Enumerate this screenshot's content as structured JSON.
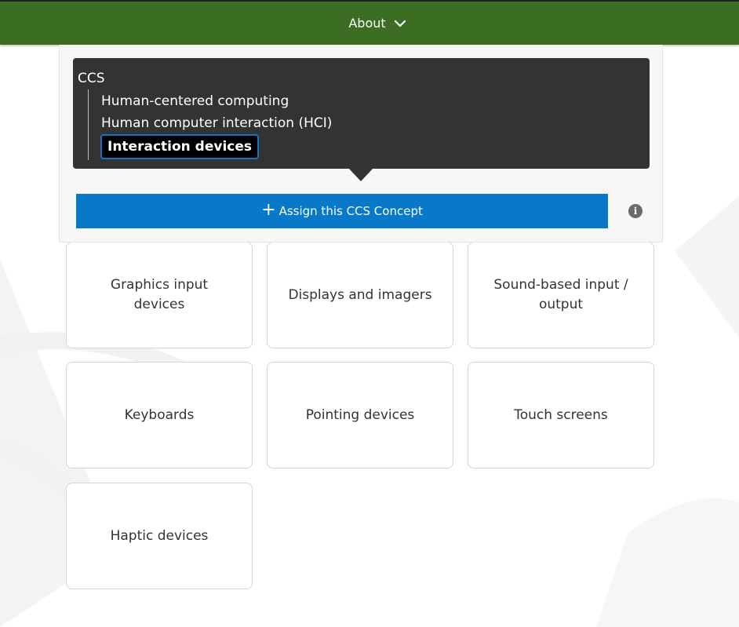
{
  "header": {
    "about_label": "About"
  },
  "breadcrumb": {
    "root": "CCS",
    "items": [
      "Human-centered computing",
      "Human computer interaction (HCI)"
    ],
    "current": "Interaction devices"
  },
  "assign": {
    "plus_glyph": "+",
    "label": "Assign this CCS Concept"
  },
  "info": {
    "glyph": "i"
  },
  "cards": [
    "Graphics input devices",
    "Displays and imagers",
    "Sound-based input / output",
    "Keyboards",
    "Pointing devices",
    "Touch screens",
    "Haptic devices"
  ],
  "colors": {
    "header_green": "#3b6e22",
    "breadcrumb_bg": "#333333",
    "assign_blue": "#0878c8",
    "focus_border": "#1a73c0"
  }
}
